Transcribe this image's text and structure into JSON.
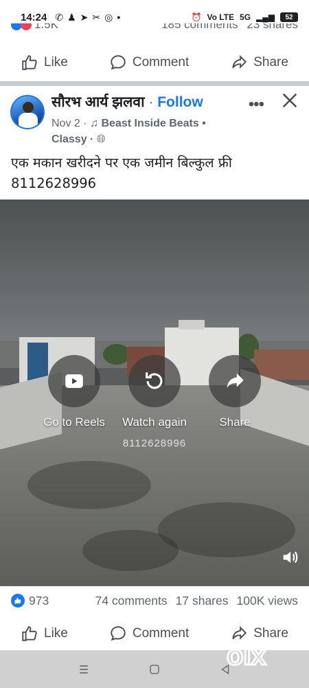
{
  "status_bar": {
    "time": "14:24",
    "notification_icons": [
      "whatsapp-icon",
      "snapchat-icon",
      "telegram-icon",
      "tool-icon",
      "instagram-icon",
      "dot-icon"
    ],
    "network_label_1": "Vo LTE",
    "network_label_2": "5G",
    "battery": "52"
  },
  "previous_post": {
    "reactions_count": "1.5K",
    "comments": "185 comments",
    "shares": "23 shares"
  },
  "actions": {
    "like": "Like",
    "comment": "Comment",
    "share": "Share"
  },
  "post": {
    "author": "सौरभ आर्य झलवा",
    "separator": "·",
    "follow": "Follow",
    "date": "Nov 2 ·",
    "music": "Beast Inside Beats •",
    "music_line2": "Classy ·",
    "caption_line1": "एक मकान खरीदने पर एक जमीन बिल्कुल फ्री",
    "caption_line2": "8112628996"
  },
  "video_overlay": {
    "go_to_reels": "Go to Reels",
    "watch_again": "Watch again",
    "share": "Share",
    "watermark_phone": "8112628996"
  },
  "engagement": {
    "likes": "973",
    "comments": "74 comments",
    "shares": "17 shares",
    "views": "100K views"
  },
  "olx_text": "olx"
}
